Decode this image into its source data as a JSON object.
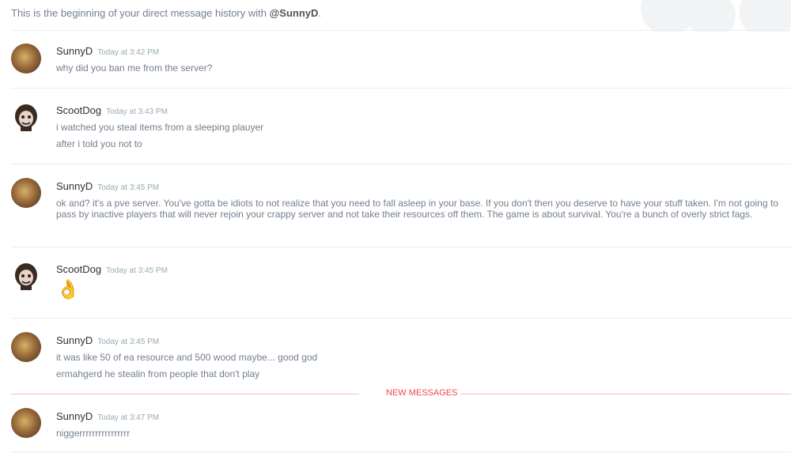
{
  "intro": {
    "prefix": "This is the beginning of your direct message history with ",
    "user": "@SunnyD",
    "suffix": "."
  },
  "messages": [
    {
      "author": "SunnyD",
      "time": "Today at 3:42 PM",
      "lines": [
        "why did you ban me from the server?"
      ]
    },
    {
      "author": "ScootDog",
      "time": "Today at 3:43 PM",
      "lines": [
        "i watched you steal items from a sleeping plauyer",
        "after i told you not to"
      ]
    },
    {
      "author": "SunnyD",
      "time": "Today at 3:45 PM",
      "lines": [
        "ok and? it's a pve server. You've gotta be idiots to not realize that you need to fall asleep in your base. If you don't then you deserve to have your stuff taken.  I'm not going to pass by inactive players that will never rejoin your crappy server and not take their resources off them.  The game is about survival. You're a bunch of overly strict fags."
      ]
    },
    {
      "author": "ScootDog",
      "time": "Today at 3:45 PM",
      "lines": [
        "👌"
      ]
    },
    {
      "author": "SunnyD",
      "time": "Today at 3:45 PM",
      "lines": [
        "it was like 50 of ea resource and 500 wood maybe... good god",
        "ermahgerd he stealin from people that don't play"
      ]
    },
    {
      "author": "SunnyD",
      "time": "Today at 3:47 PM",
      "lines": [
        "niggerrrrrrrrrrrrrrrr"
      ]
    }
  ],
  "new_messages_label": "NEW MESSAGES",
  "colors": {
    "accent_red": "#f04747",
    "username": "#2e3136",
    "text": "#737f8d",
    "timestamp": "#99aab5"
  }
}
